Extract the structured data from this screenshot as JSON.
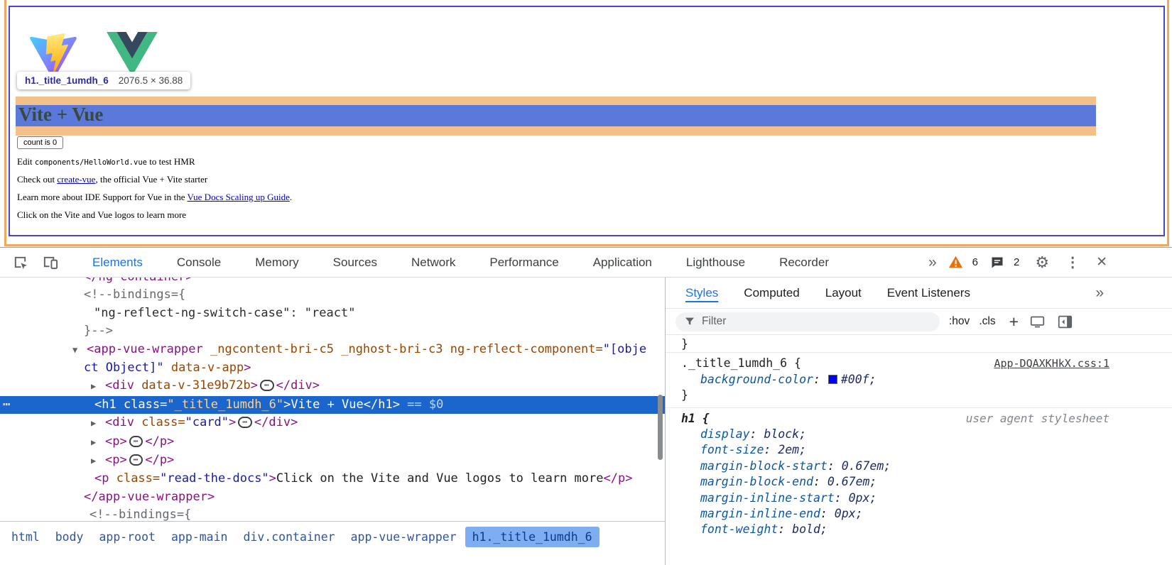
{
  "page": {
    "tooltip": {
      "selector": "h1._title_1umdh_6",
      "size": "2076.5 × 36.88"
    },
    "heading": "Vite + Vue",
    "counter_button": "count is 0",
    "lines": {
      "edit": {
        "pre": "Edit ",
        "code": "components/HelloWorld.vue",
        "post": " to test HMR"
      },
      "checkout": {
        "pre": "Check out ",
        "link": "create-vue",
        "post": ", the official Vue + Vite starter"
      },
      "ide": {
        "pre": "Learn more about IDE Support for Vue in the ",
        "link": "Vue Docs Scaling up Guide",
        "post": "."
      },
      "logos": "Click on the Vite and Vue logos to learn more"
    }
  },
  "toolbar": {
    "tabs": [
      {
        "label": "Elements",
        "selected": true
      },
      {
        "label": "Console"
      },
      {
        "label": "Memory"
      },
      {
        "label": "Sources"
      },
      {
        "label": "Network"
      },
      {
        "label": "Performance"
      },
      {
        "label": "Application"
      },
      {
        "label": "Lighthouse"
      },
      {
        "label": "Recorder"
      }
    ],
    "more_tabs": "»",
    "warning_count": "6",
    "issues_count": "2"
  },
  "elements_panel": {
    "lines": [
      {
        "i": 118,
        "tok": [
          [
            "tag",
            "</ng-container>"
          ]
        ]
      },
      {
        "i": 118,
        "tok": [
          [
            "com",
            "<!--bindings={"
          ]
        ]
      },
      {
        "i": 132,
        "tok": [
          [
            "comdark",
            "\"ng-reflect-ng-switch-case\": \"react\""
          ]
        ]
      },
      {
        "i": 118,
        "tok": [
          [
            "com",
            "}-->"
          ]
        ]
      },
      {
        "i": 102,
        "tok": [
          [
            "arrow",
            "▼"
          ],
          [
            "tag",
            "<app-vue-wrapper"
          ],
          [
            "attr",
            " _ngcontent-bri-c5 _nghost-bri-c3 ng-reflect-component="
          ],
          [
            "val",
            "\"[obje"
          ]
        ]
      },
      {
        "i": 118,
        "tok": [
          [
            "val",
            "ct Object]\""
          ],
          [
            "attr",
            " data-v-app"
          ],
          [
            "tag",
            ">"
          ]
        ]
      },
      {
        "i": 128,
        "tok": [
          [
            "arrow",
            "▶"
          ],
          [
            "tag",
            "<div"
          ],
          [
            "attr",
            " data-v-31e9b72b"
          ],
          [
            "tag",
            ">"
          ],
          [
            "dots",
            "⋯"
          ],
          [
            "tag",
            "</div>"
          ]
        ]
      },
      {
        "i": 133,
        "sel": true,
        "gutter": true,
        "tok": [
          [
            "tag",
            "<h1"
          ],
          [
            "attr",
            " class="
          ],
          [
            "val",
            "\"_title_1umdh_6\""
          ],
          [
            "tag",
            ">"
          ],
          [
            "txt",
            "Vite + Vue"
          ],
          [
            "tag",
            "</h1>"
          ],
          [
            "eq",
            " == $0"
          ]
        ]
      },
      {
        "i": 128,
        "tok": [
          [
            "arrow",
            "▶"
          ],
          [
            "tag",
            "<div"
          ],
          [
            "attr",
            " class="
          ],
          [
            "val",
            "\"card\""
          ],
          [
            "tag",
            ">"
          ],
          [
            "dots",
            "⋯"
          ],
          [
            "tag",
            "</div>"
          ]
        ]
      },
      {
        "i": 128,
        "tok": [
          [
            "arrow",
            "▶"
          ],
          [
            "tag",
            "<p>"
          ],
          [
            "dots",
            "⋯"
          ],
          [
            "tag",
            "</p>"
          ]
        ]
      },
      {
        "i": 128,
        "tok": [
          [
            "arrow",
            "▶"
          ],
          [
            "tag",
            "<p>"
          ],
          [
            "dots",
            "⋯"
          ],
          [
            "tag",
            "</p>"
          ]
        ]
      },
      {
        "i": 133,
        "tok": [
          [
            "tag",
            "<p"
          ],
          [
            "attr",
            " class="
          ],
          [
            "val",
            "\"read-the-docs\""
          ],
          [
            "tag",
            ">"
          ],
          [
            "txt",
            "Click on the Vite and Vue logos to learn more"
          ],
          [
            "tag",
            "</p>"
          ]
        ]
      },
      {
        "i": 118,
        "tok": [
          [
            "tag",
            "</app-vue-wrapper>"
          ]
        ]
      },
      {
        "i": 126,
        "tok": [
          [
            "com",
            "<!--bindings={"
          ]
        ]
      }
    ],
    "breadcrumbs": [
      {
        "label": "html"
      },
      {
        "label": "body"
      },
      {
        "label": "app-root"
      },
      {
        "label": "app-main"
      },
      {
        "label": "div.container"
      },
      {
        "label": "app-vue-wrapper"
      },
      {
        "label": "h1._title_1umdh_6",
        "selected": true
      }
    ]
  },
  "styles_panel": {
    "tabs": [
      {
        "label": "Styles",
        "selected": true
      },
      {
        "label": "Computed"
      },
      {
        "label": "Layout"
      },
      {
        "label": "Event Listeners"
      }
    ],
    "more_tabs": "»",
    "filter_placeholder": "Filter",
    "pseudo_toggle": ":hov",
    "class_toggle": ".cls",
    "new_rule": "+",
    "orphan_close": "}",
    "rules": [
      {
        "selector": "._title_1umdh_6 {",
        "source": "App-DQAXKHkX.css:1",
        "source_type": "file",
        "decls": [
          {
            "prop": "background-color",
            "value": "#00f;",
            "swatch": "#0000ff"
          }
        ],
        "close": "}"
      },
      {
        "selector": "h1 {",
        "bold": true,
        "source": "user agent stylesheet",
        "source_type": "ua",
        "decls": [
          {
            "prop": "display",
            "value": "block;"
          },
          {
            "prop": "font-size",
            "value": "2em;"
          },
          {
            "prop": "margin-block-start",
            "value": "0.67em;"
          },
          {
            "prop": "margin-block-end",
            "value": "0.67em;"
          },
          {
            "prop": "margin-inline-start",
            "value": "0px;"
          },
          {
            "prop": "margin-inline-end",
            "value": "0px;"
          },
          {
            "prop": "font-weight",
            "value": "bold;"
          }
        ]
      }
    ]
  },
  "colors": {
    "accent": "#1a73e8",
    "tree_selection": "#1a66cc",
    "margin_overlay": "#f3c08c",
    "content_overlay": "#5b79da",
    "css_swatch": "#0000ff",
    "warning": "#e8710a",
    "vue_green": "#41b883",
    "vue_navy": "#35495e"
  }
}
